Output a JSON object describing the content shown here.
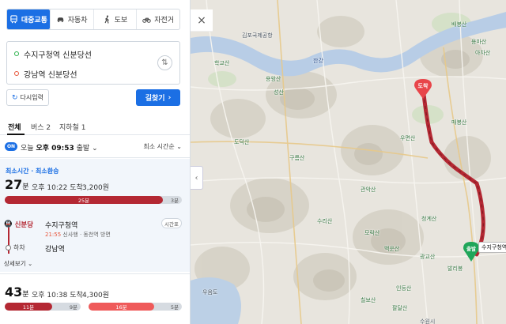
{
  "modes": [
    {
      "label": "대중교통",
      "icon": "bus-icon",
      "active": true
    },
    {
      "label": "자동차",
      "icon": "car-icon",
      "active": false
    },
    {
      "label": "도보",
      "icon": "walk-icon",
      "active": false
    },
    {
      "label": "자전거",
      "icon": "bicycle-icon",
      "active": false
    }
  ],
  "route": {
    "start": "수지구청역 신분당선",
    "end": "강남역 신분당선"
  },
  "buttons": {
    "reset": "다시입력",
    "find": "길찾기"
  },
  "tabs": [
    {
      "label": "전체",
      "active": true
    },
    {
      "label": "버스 2",
      "active": false
    },
    {
      "label": "지하철 1",
      "active": false
    }
  ],
  "options": {
    "on_badge": "ON",
    "departure_prefix": "오늘",
    "departure_time": "오후 09:53",
    "departure_suffix": "출발",
    "sort": "최소 시간순"
  },
  "results": [
    {
      "tag": "최소시간 · 최소환승",
      "duration": "27",
      "duration_unit": "분",
      "arrival": "오후 10:22 도착",
      "fare": "3,200원",
      "segments": [
        {
          "label": "25분",
          "type": "subway",
          "color": "#b42833",
          "share": 0.89
        },
        {
          "label": "3분",
          "type": "walk",
          "color": "#d6dbe1",
          "share": 0.11
        }
      ],
      "board": {
        "line": "신분당",
        "station": "수지구청역",
        "time_button": "시간표",
        "train_time": "21:55",
        "train_desc": "신사행 · 동천역 방면"
      },
      "alight": {
        "label": "하차",
        "station": "강남역"
      },
      "more": "상세보기"
    },
    {
      "duration": "43",
      "duration_unit": "분",
      "arrival": "오후 10:38 도착",
      "fare": "4,300원",
      "segments": [
        {
          "label": "11분",
          "type": "bus",
          "color": "#b42833",
          "share": 0.26
        },
        {
          "label": "9분",
          "type": "walk",
          "color": "#d6dbe1",
          "share": 0.2
        },
        {
          "label": "16분",
          "type": "bus",
          "color": "#ef5a5a",
          "share": 0.36
        },
        {
          "label": "5분",
          "type": "walk",
          "color": "#d6dbe1",
          "share": 0.18
        }
      ]
    }
  ],
  "map": {
    "dest_pin": "도착",
    "start_pin": "출발",
    "start_label": "수지구청역",
    "close": "×",
    "labels": [
      {
        "t": "한강",
        "cls": "b"
      },
      {
        "t": "김포국제공항",
        "cls": ""
      },
      {
        "t": "배봉산",
        "cls": "g"
      },
      {
        "t": "용마산",
        "cls": "g"
      },
      {
        "t": "아차산",
        "cls": "g"
      },
      {
        "t": "매봉산",
        "cls": "g"
      },
      {
        "t": "우면산",
        "cls": "g"
      },
      {
        "t": "관악산",
        "cls": "g"
      },
      {
        "t": "청계산",
        "cls": "g"
      },
      {
        "t": "인등산",
        "cls": "g"
      },
      {
        "t": "학교산",
        "cls": "g"
      },
      {
        "t": "용왕산",
        "cls": "g"
      },
      {
        "t": "성산",
        "cls": "g"
      },
      {
        "t": "도덕산",
        "cls": "g"
      },
      {
        "t": "구름산",
        "cls": "g"
      },
      {
        "t": "수리산",
        "cls": "g"
      },
      {
        "t": "모락산",
        "cls": "g"
      },
      {
        "t": "백운산",
        "cls": "g"
      },
      {
        "t": "광교산",
        "cls": "g"
      },
      {
        "t": "발리봉",
        "cls": "g"
      },
      {
        "t": "칠보산",
        "cls": "g"
      },
      {
        "t": "팔달산",
        "cls": "g"
      },
      {
        "t": "수원시",
        "cls": ""
      },
      {
        "t": "우음도",
        "cls": ""
      }
    ]
  }
}
